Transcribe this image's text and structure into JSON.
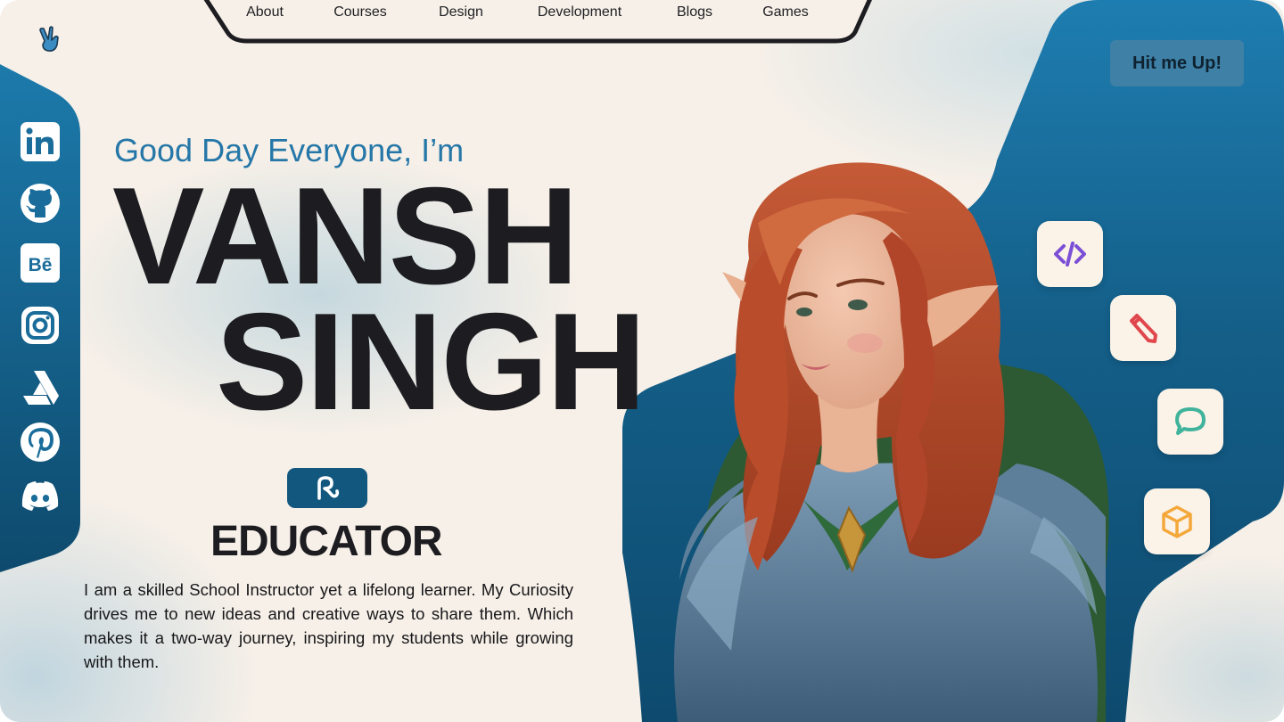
{
  "nav": {
    "items": [
      "About",
      "Courses",
      "Design",
      "Development",
      "Blogs",
      "Games"
    ]
  },
  "header": {
    "logo_icon": "victory-hand-icon",
    "cta_label": "Hit me Up!"
  },
  "social": [
    {
      "name": "linkedin-icon"
    },
    {
      "name": "github-icon"
    },
    {
      "name": "behance-icon"
    },
    {
      "name": "instagram-icon"
    },
    {
      "name": "artstation-icon"
    },
    {
      "name": "pinterest-icon"
    },
    {
      "name": "discord-icon"
    }
  ],
  "hero": {
    "greeting": "Good Day Everyone, I’m",
    "first_name": "VANSH",
    "last_name": "SINGH",
    "badge_icon": "signature-icon",
    "role": "EDUCATOR",
    "bio": "I am a skilled School Instructor yet a lifelong learner. My Curiosity drives me to new ideas and creative ways to share them. Which makes it a two-way journey, inspiring my students while growing with them."
  },
  "skills": [
    {
      "icon": "code-icon",
      "color": "#7b4fd6"
    },
    {
      "icon": "pencil-icon",
      "color": "#e0474c"
    },
    {
      "icon": "chat-bubble-icon",
      "color": "#3fb39b"
    },
    {
      "icon": "box-icon",
      "color": "#f4a83a"
    }
  ],
  "colors": {
    "accent_blue": "#2577a8",
    "panel_blue": "#12577e",
    "text_dark": "#1d1d21",
    "background": "#f7f0e8"
  },
  "illustration": "elf-woman-portrait"
}
